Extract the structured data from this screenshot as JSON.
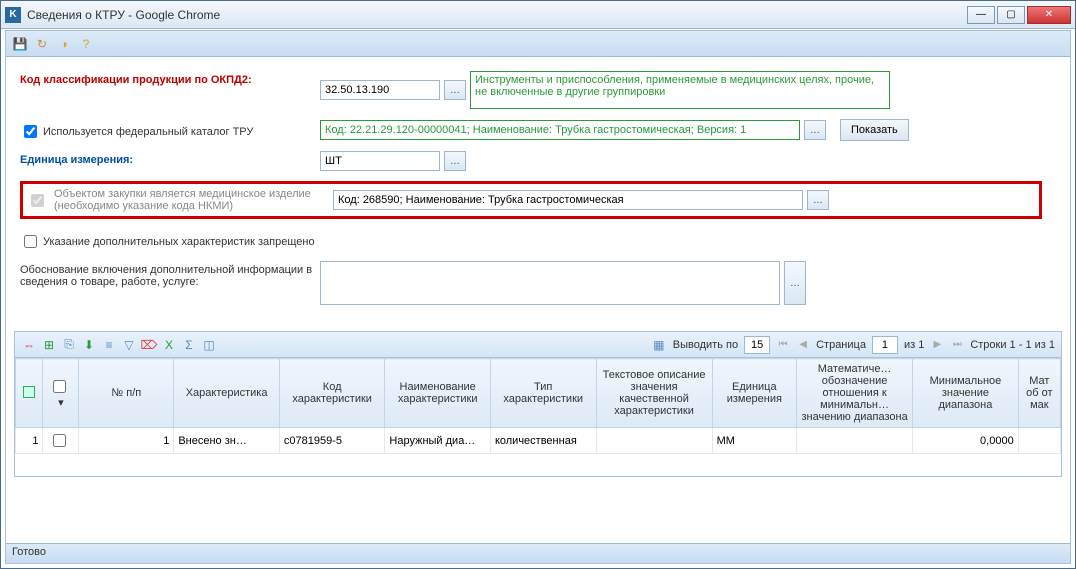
{
  "window": {
    "title": "Сведения о КТРУ - Google Chrome"
  },
  "toolbar": {
    "save": "save",
    "refresh": "refresh",
    "coin": "coin",
    "help": "help"
  },
  "form": {
    "okpd2_label": "Код классификации продукции по ОКПД2:",
    "okpd2_value": "32.50.13.190",
    "okpd2_desc": "Инструменты и приспособления, применяемые в медицинских целях, прочие, не включенные в другие группировки",
    "use_fed_label": "Используется федеральный каталог ТРУ",
    "fed_value": "Код: 22.21.29.120-00000041; Наименование: Трубка гастростомическая; Версия: 1",
    "show_btn": "Показать",
    "unit_label": "Единица измерения:",
    "unit_value": "ШТ",
    "med_chk_label": "Объектом закупки является медицинское изделие (необходимо указание кода НКМИ)",
    "med_value": "Код: 268590; Наименование: Трубка гастростомическая",
    "extra_chk_label": "Указание дополнительных характеристик запрещено",
    "justif_label": "Обоснование включения дополнительной информации в сведения о товаре, работе, услуге:",
    "justif_value": ""
  },
  "grid": {
    "per_page_label": "Выводить по",
    "per_page": "15",
    "page_label": "Страница",
    "page": "1",
    "of_label": "из 1",
    "rows_label": "Строки 1 - 1 из 1",
    "cols": {
      "c0": "",
      "c1": "",
      "c2": "№ п/п",
      "c3": "Характеристика",
      "c4": "Код характеристики",
      "c5": "Наименование характеристики",
      "c6": "Тип характеристики",
      "c7": "Текстовое описание значения качественной характеристики",
      "c8": "Единица измерения",
      "c9": "Математиче… обозначение отношения к минимальн… значению диапазона",
      "c10": "Минимальное значение диапазона",
      "c11": "Мат об от мак"
    },
    "row1": {
      "n": "1",
      "idx": "1",
      "char": "Внесено зн…",
      "code": "c0781959-5",
      "name": "Наружный диа…",
      "type": "количественная",
      "desc": "",
      "unit": "ММ",
      "rel": "",
      "minv": "0,0000",
      "rel2": ""
    }
  },
  "status": "Готово"
}
